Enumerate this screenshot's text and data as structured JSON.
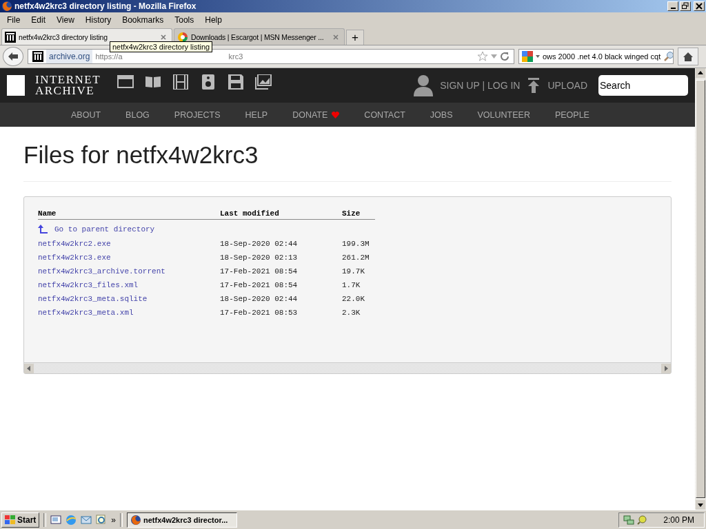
{
  "window": {
    "title": "netfx4w2krc3 directory listing - Mozilla Firefox"
  },
  "menu": [
    "File",
    "Edit",
    "View",
    "History",
    "Bookmarks",
    "Tools",
    "Help"
  ],
  "tabs": [
    {
      "label": "netfx4w2krc3 directory listing",
      "selected": true
    },
    {
      "label": "Downloads | Escargot | MSN Messenger ...",
      "selected": false
    }
  ],
  "new_tab": "+",
  "address_bar": {
    "site": "archive.org",
    "url_start": "https://a",
    "url_end": "krc3"
  },
  "tooltip": "netfx4w2krc3 directory listing",
  "search_bar": {
    "value": "ows 2000 .net 4.0 black winged cqt"
  },
  "site_header": {
    "logo_lines": [
      "INTERNET",
      "ARCHIVE"
    ],
    "account": "SIGN UP | LOG IN",
    "upload": "UPLOAD",
    "search_placeholder": "Search"
  },
  "site_nav": [
    {
      "label": "ABOUT"
    },
    {
      "label": "BLOG"
    },
    {
      "label": "PROJECTS"
    },
    {
      "label": "HELP"
    },
    {
      "label": "DONATE",
      "heart": true
    },
    {
      "label": "CONTACT"
    },
    {
      "label": "JOBS"
    },
    {
      "label": "VOLUNTEER"
    },
    {
      "label": "PEOPLE"
    }
  ],
  "heading": "Files for netfx4w2krc3",
  "listing": {
    "columns": [
      "Name",
      "Last modified",
      "Size"
    ],
    "parent_link": "Go to parent directory",
    "rows": [
      [
        "netfx4w2krc2.exe",
        "18-Sep-2020 02:44",
        "199.3M"
      ],
      [
        "netfx4w2krc3.exe",
        "18-Sep-2020 02:13",
        "261.2M"
      ],
      [
        "netfx4w2krc3_archive.torrent",
        "17-Feb-2021 08:54",
        "19.7K"
      ],
      [
        "netfx4w2krc3_files.xml",
        "17-Feb-2021 08:54",
        "1.7K"
      ],
      [
        "netfx4w2krc3_meta.sqlite",
        "18-Sep-2020 02:44",
        "22.0K"
      ],
      [
        "netfx4w2krc3_meta.xml",
        "17-Feb-2021 08:53",
        "2.3K"
      ]
    ]
  },
  "taskbar": {
    "start": "Start",
    "more": "»",
    "task": "netfx4w2krc3 director...",
    "clock": "2:00 PM"
  }
}
